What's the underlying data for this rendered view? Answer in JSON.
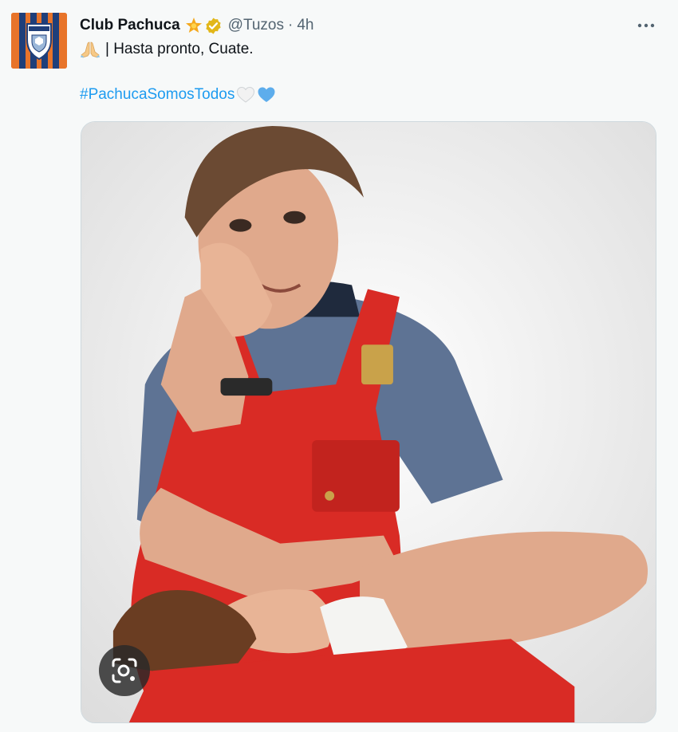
{
  "tweet": {
    "author_name": "Club Pachuca",
    "author_handle": "@Tuzos",
    "separator": "·",
    "time": "4h",
    "text": "| Hasta pronto, Cuate.",
    "hashtag": "#PachucaSomosTodos",
    "icons": {
      "avatar": "pachuca-crest-icon",
      "star_badge": "gold-star-badge-icon",
      "verified_badge": "gold-verified-badge-icon",
      "more": "more-options-icon",
      "pray_emoji": "folded-hands-emoji-icon",
      "white_heart": "white-heart-emoji-icon",
      "blue_heart": "blue-heart-emoji-icon",
      "lens": "google-lens-icon"
    }
  },
  "colors": {
    "background": "#f7f9f9",
    "text": "#0f1419",
    "secondary_text": "#536471",
    "link": "#1d9bf0",
    "gold_badge": "#e2b719",
    "brand_orange": "#e8742a",
    "brand_navy": "#1f3f7a"
  }
}
